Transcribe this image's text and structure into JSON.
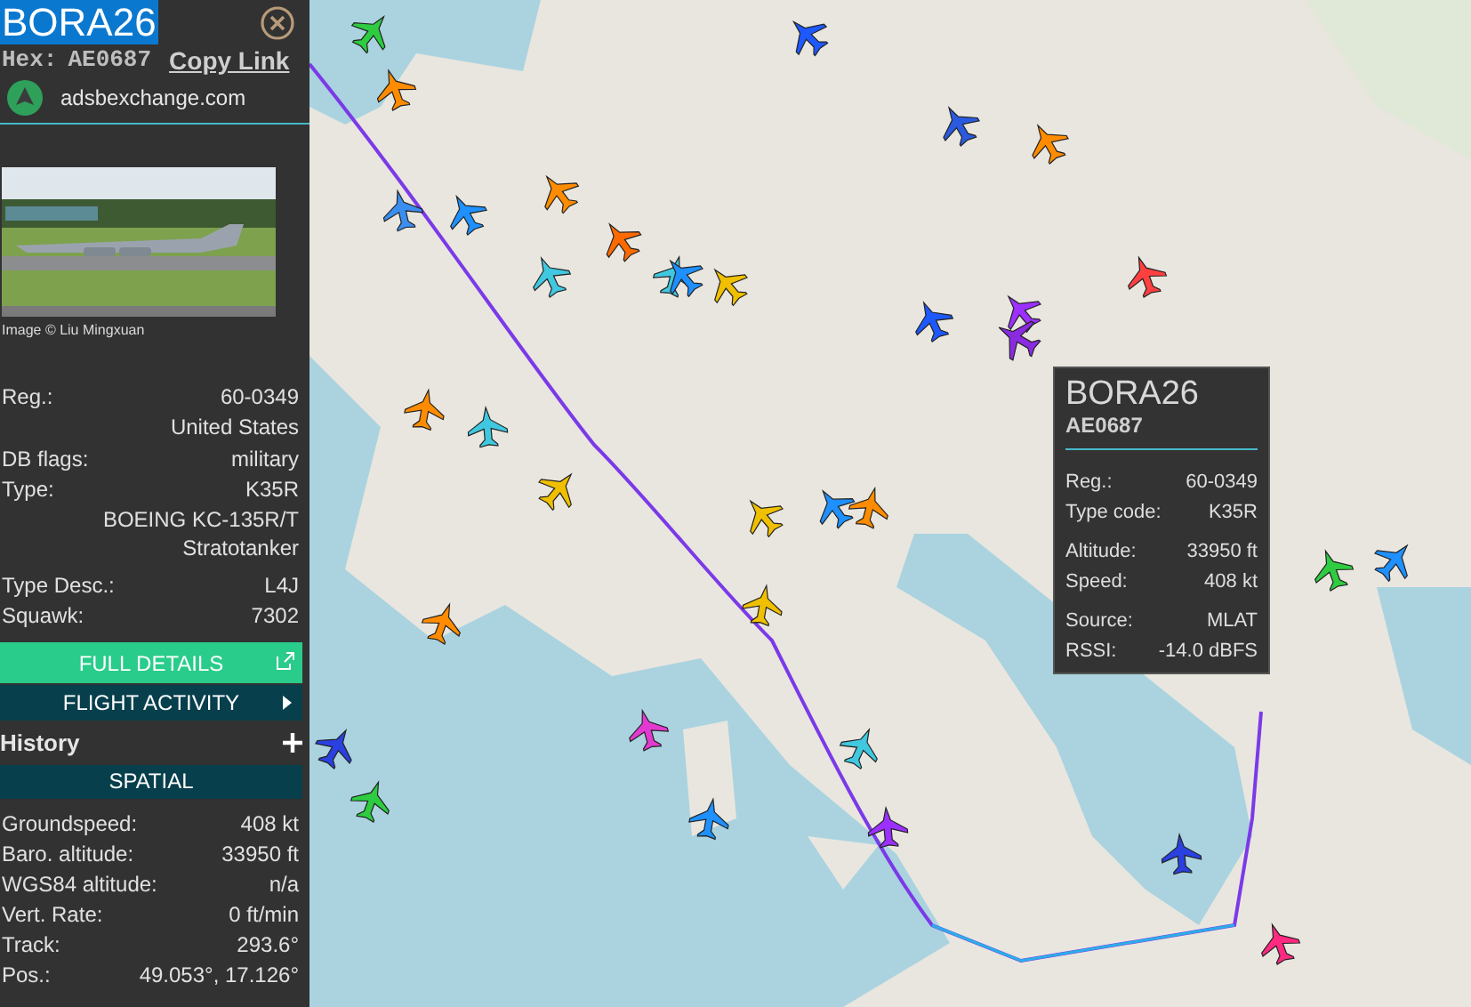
{
  "header": {
    "callsign": "BORA26",
    "hex_label": "Hex:",
    "hex": "AE0687",
    "copy_link": "Copy Link",
    "site": "adsbexchange.com"
  },
  "photo": {
    "kind": "picture",
    "caption": "Image © Liu Mingxuan"
  },
  "details": [
    {
      "label": "Reg.:",
      "value": "60-0349"
    },
    {
      "value": "United States"
    },
    {
      "label": "DB flags:",
      "value": "military"
    },
    {
      "label": "Type:",
      "value": "K35R"
    },
    {
      "value": "BOEING KC-135R/T Stratotanker"
    },
    {
      "label": "Type Desc.:",
      "value": "L4J"
    },
    {
      "label": "Squawk:",
      "value": "7302"
    }
  ],
  "full_details": "FULL DETAILS",
  "flight_activity": "FLIGHT ACTIVITY",
  "history": "History",
  "spatial": {
    "title": "SPATIAL",
    "rows": [
      {
        "label": "Groundspeed:",
        "value": "408 kt"
      },
      {
        "label": "Baro. altitude:",
        "value": "33950 ft"
      },
      {
        "label": "WGS84 altitude:",
        "value": "n/a"
      },
      {
        "label": "Vert. Rate:",
        "value": "0 ft/min"
      },
      {
        "label": "Track:",
        "value": "293.6°"
      },
      {
        "label": "Pos.:",
        "value": "49.053°, 17.126°"
      }
    ]
  },
  "tooltip": {
    "callsign": "BORA26",
    "hex": "AE0687",
    "groups": [
      [
        {
          "label": "Reg.:",
          "value": "60-0349"
        },
        {
          "label": "Type code:",
          "value": "K35R"
        }
      ],
      [
        {
          "label": "Altitude:",
          "value": "33950 ft"
        },
        {
          "label": "Speed:",
          "value": "408 kt"
        }
      ],
      [
        {
          "label": "Source:",
          "value": "MLAT"
        },
        {
          "label": "RSSI:",
          "value": "-14.0 dBFS"
        }
      ]
    ]
  }
}
